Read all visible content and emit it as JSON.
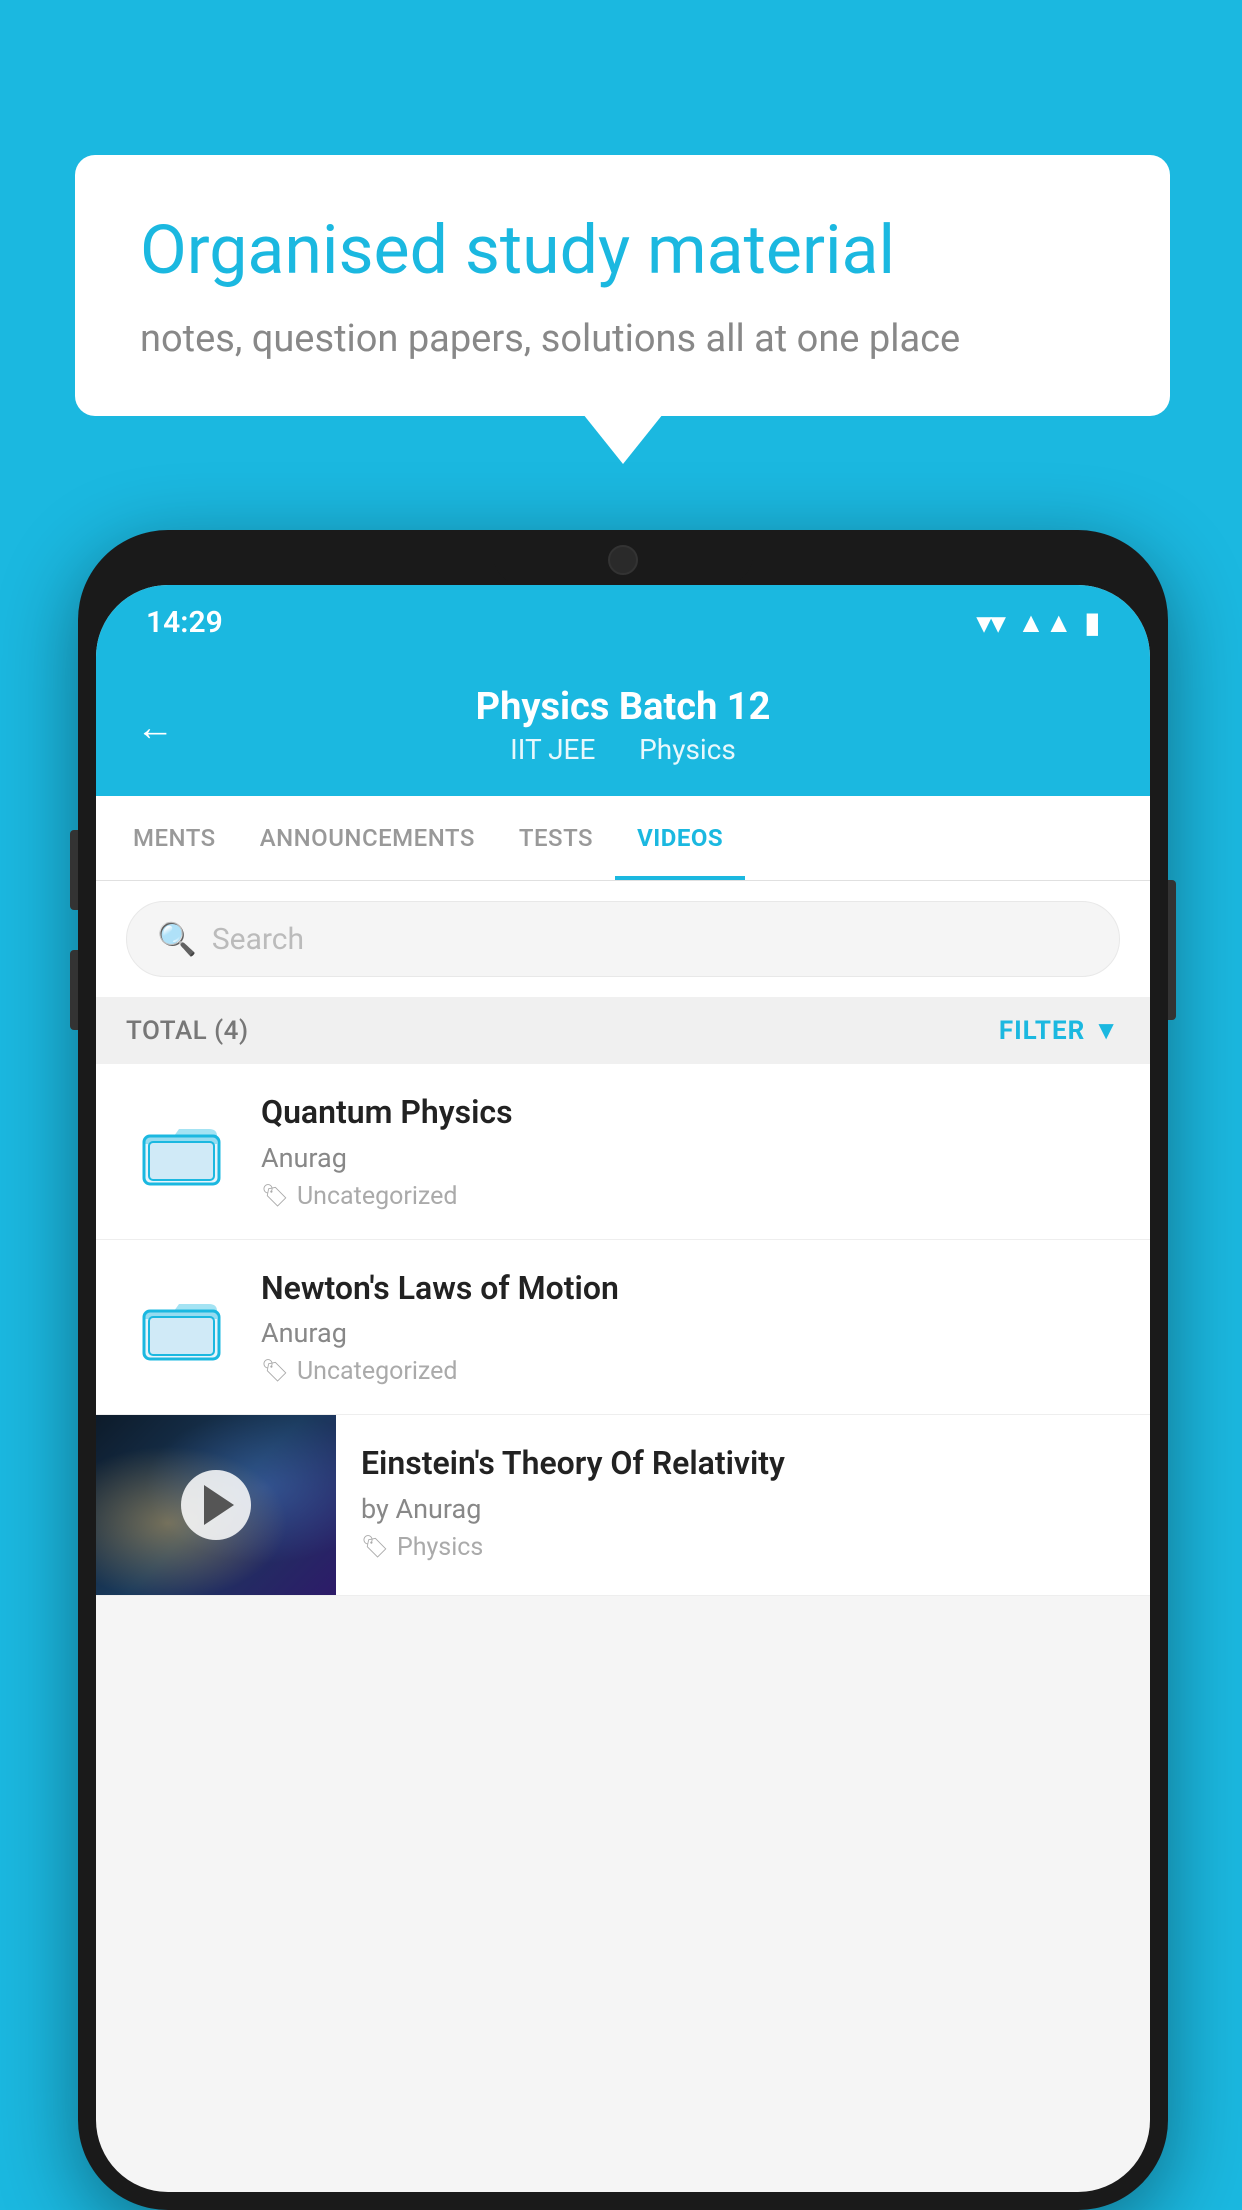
{
  "background": {
    "color": "#1BB8E0"
  },
  "speech_bubble": {
    "title": "Organised study material",
    "subtitle": "notes, question papers, solutions all at one place"
  },
  "status_bar": {
    "time": "14:29"
  },
  "app_header": {
    "back_label": "←",
    "title": "Physics Batch 12",
    "tag1": "IIT JEE",
    "tag2": "Physics"
  },
  "tabs": [
    {
      "label": "MENTS",
      "active": false
    },
    {
      "label": "ANNOUNCEMENTS",
      "active": false
    },
    {
      "label": "TESTS",
      "active": false
    },
    {
      "label": "VIDEOS",
      "active": true
    }
  ],
  "search": {
    "placeholder": "Search"
  },
  "filter_row": {
    "total_label": "TOTAL (4)",
    "filter_label": "FILTER"
  },
  "video_items": [
    {
      "type": "folder",
      "title": "Quantum Physics",
      "author": "Anurag",
      "tag": "Uncategorized"
    },
    {
      "type": "folder",
      "title": "Newton's Laws of Motion",
      "author": "Anurag",
      "tag": "Uncategorized"
    },
    {
      "type": "video",
      "title": "Einstein's Theory Of Relativity",
      "author": "by Anurag",
      "tag": "Physics"
    }
  ]
}
